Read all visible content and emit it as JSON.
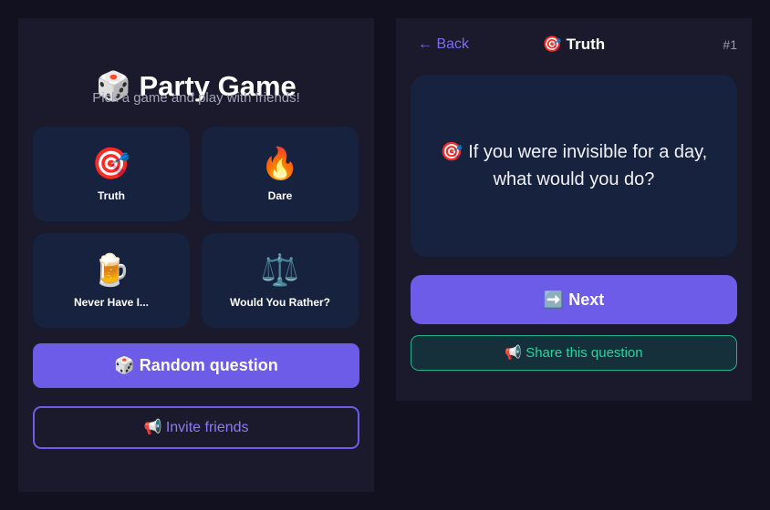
{
  "home": {
    "title": "🎲 Party Game",
    "subtitle": "Pick a game and play with friends!",
    "modes": [
      {
        "icon": "🎯",
        "icon_name": "target-icon",
        "label": "Truth"
      },
      {
        "icon": "🔥",
        "icon_name": "fire-icon",
        "label": "Dare"
      },
      {
        "icon": "🍺",
        "icon_name": "beer-mug-icon",
        "label": "Never Have I..."
      },
      {
        "icon": "⚖️",
        "icon_name": "scales-icon",
        "label": "Would You Rather?"
      }
    ],
    "random_label": "🎲 Random question",
    "invite_label": "📢 Invite friends"
  },
  "question_view": {
    "back_label": "← Back",
    "category_title": "🎯 Truth",
    "question_number": "#1",
    "question_text": "🎯 If you were invisible for a day, what would you do?",
    "next_label": "➡️ Next",
    "share_label": "📢 Share this question"
  },
  "colors": {
    "background": "#111120",
    "panel": "#1a1a2c",
    "card": "#16223e",
    "accent": "#6c5ce7",
    "share_accent": "#2bd39f",
    "muted_text": "#a2a2b8"
  }
}
